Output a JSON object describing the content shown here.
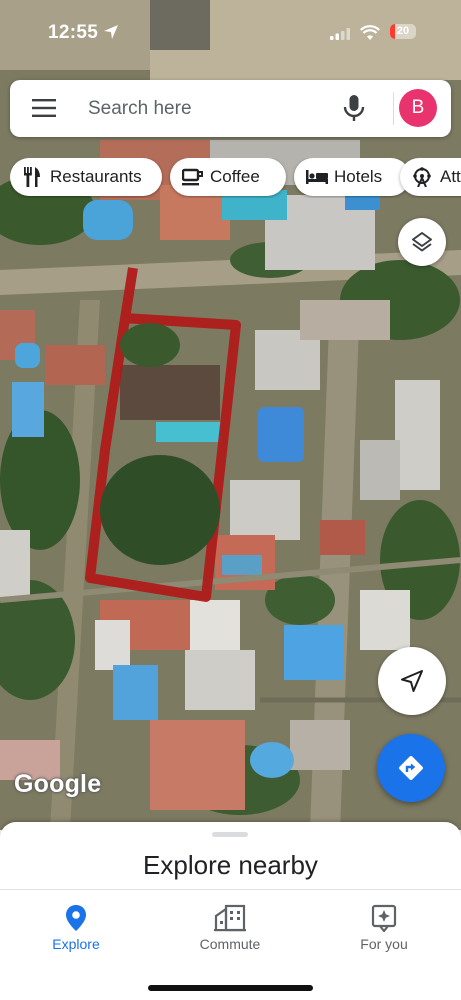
{
  "status_bar": {
    "time": "12:55",
    "battery": "20"
  },
  "search": {
    "placeholder": "Search here",
    "avatar_letter": "B"
  },
  "chips": [
    {
      "label": "Restaurants",
      "icon": "fork-knife-icon"
    },
    {
      "label": "Coffee",
      "icon": "coffee-cup-icon"
    },
    {
      "label": "Hotels",
      "icon": "bed-icon"
    },
    {
      "label": "Att",
      "icon": "attractions-icon"
    }
  ],
  "map": {
    "attribution": "Google"
  },
  "sheet": {
    "title": "Explore nearby"
  },
  "bottom_nav": [
    {
      "label": "Explore",
      "icon": "location-pin-icon",
      "active": true
    },
    {
      "label": "Commute",
      "icon": "commute-buildings-icon",
      "active": false
    },
    {
      "label": "For you",
      "icon": "sparkle-icon",
      "active": false
    }
  ],
  "colors": {
    "accent": "#1a73e8",
    "avatar": "#e8336e",
    "boundary": "#b01818"
  }
}
